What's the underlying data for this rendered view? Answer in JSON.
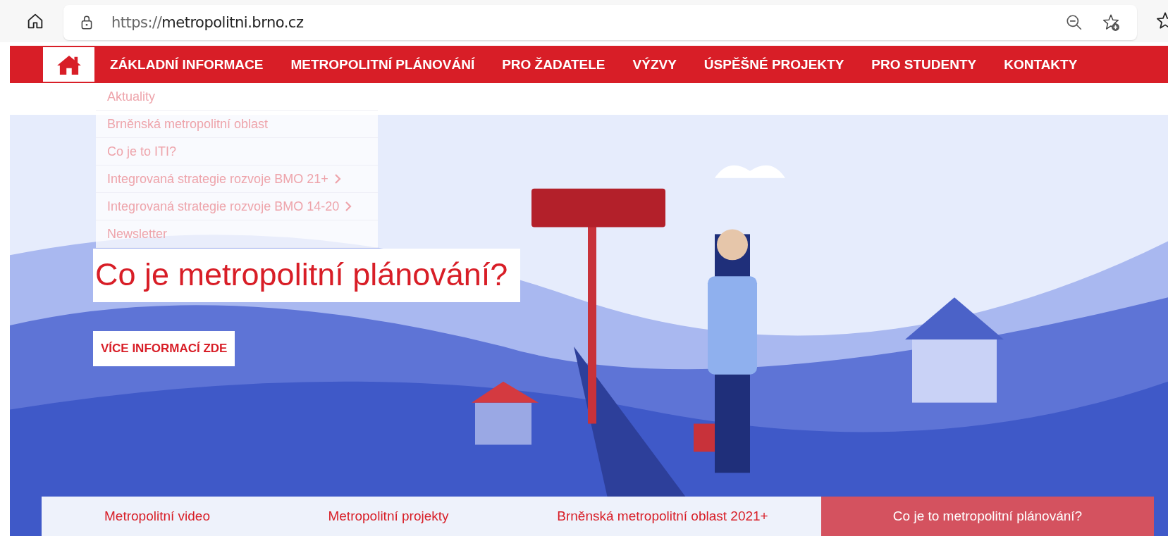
{
  "browser": {
    "url_scheme": "https://",
    "url_host": "metropolitni.brno.cz"
  },
  "nav": {
    "items": [
      {
        "label": "ZÁKLADNÍ INFORMACE"
      },
      {
        "label": "METROPOLITNÍ PLÁNOVÁNÍ"
      },
      {
        "label": "PRO ŽADATELE"
      },
      {
        "label": "VÝZVY"
      },
      {
        "label": "ÚSPĚŠNÉ PROJEKTY"
      },
      {
        "label": "PRO STUDENTY"
      },
      {
        "label": "KONTAKTY"
      }
    ]
  },
  "dropdown": {
    "items": [
      {
        "label": "Aktuality",
        "has_submenu": false
      },
      {
        "label": "Brněnská metropolitní oblast",
        "has_submenu": false
      },
      {
        "label": "Co je to ITI?",
        "has_submenu": false
      },
      {
        "label": "Integrovaná strategie rozvoje BMO 21+",
        "has_submenu": true
      },
      {
        "label": "Integrovaná strategie rozvoje BMO 14-20",
        "has_submenu": true
      },
      {
        "label": "Newsletter",
        "has_submenu": false
      }
    ]
  },
  "hero": {
    "title": "Co je metropolitní plánování?",
    "button": "VÍCE INFORMACÍ ZDE"
  },
  "tabs": [
    {
      "label": "Metropolitní video",
      "selected": false
    },
    {
      "label": "Metropolitní projekty",
      "selected": false
    },
    {
      "label": "Brněnská metropolitní oblast 2021+",
      "selected": false
    },
    {
      "label": "Co je to metropolitní plánování?",
      "selected": true
    }
  ]
}
